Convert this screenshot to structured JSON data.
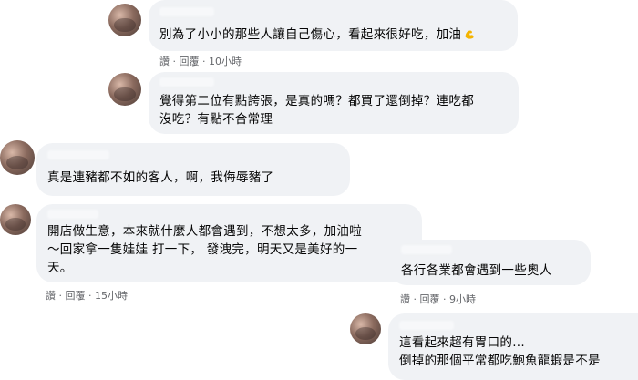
{
  "comments": [
    {
      "text_lines": [
        "別為了小小的那些人讓自己傷心，看起來很好吃，加油"
      ],
      "emoji": "muscle-icon",
      "actions": {
        "like": "讚",
        "sep1": "·",
        "reply": "回覆",
        "sep2": "·",
        "time": "10小時"
      }
    },
    {
      "text_lines": [
        "覺得第二位有點誇張，是真的嗎？都買了還倒掉？連吃都",
        "沒吃？有點不合常理"
      ]
    },
    {
      "text_lines": [
        "真是連豬都不如的客人，啊，我侮辱豬了"
      ]
    },
    {
      "text_lines": [
        "開店做生意，本來就什麼人都會遇到，不想太多，加油啦",
        "～回家拿一隻娃娃 打一下， 發洩完，明天又是美好的一",
        "天。"
      ],
      "actions": {
        "like": "讚",
        "sep1": "·",
        "reply": "回覆",
        "sep2": "·",
        "time": "15小時"
      }
    },
    {
      "text_lines": [
        "各行各業都會遇到一些奧人"
      ],
      "actions": {
        "like": "讚",
        "sep1": "·",
        "reply": "回覆",
        "sep2": "·",
        "time": "9小時"
      }
    },
    {
      "text_lines": [
        "這看起來超有胃口的...",
        "倒掉的那個平常都吃鮑魚龍蝦是不是"
      ]
    }
  ],
  "colors": {
    "bubble": "#f0f2f5",
    "meta": "#65676b",
    "text": "#050505"
  }
}
